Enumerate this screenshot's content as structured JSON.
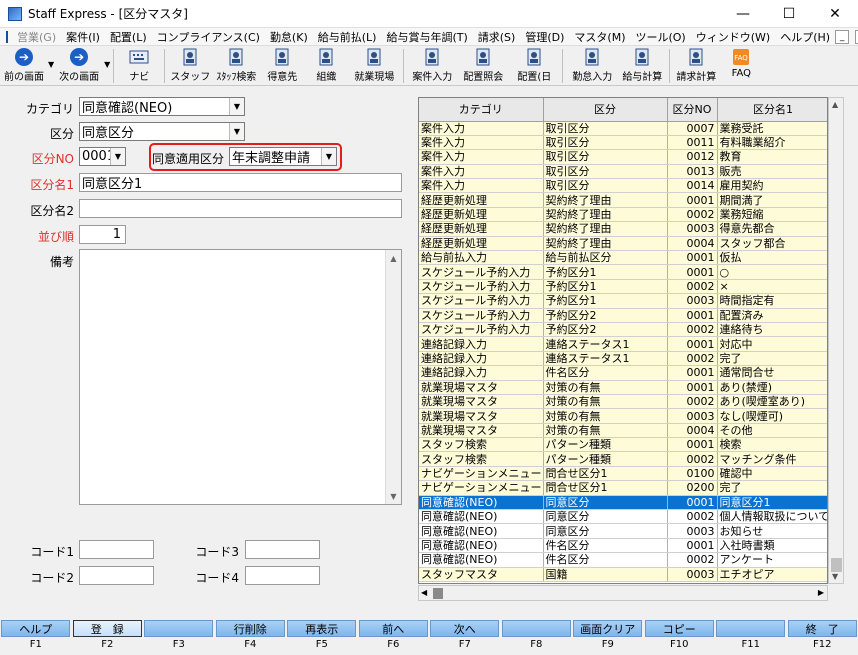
{
  "window": {
    "title": "Staff Express - [区分マスタ]"
  },
  "menu": [
    {
      "label": "営業(G)",
      "disabled": true
    },
    {
      "label": "案件(I)"
    },
    {
      "label": "配置(L)"
    },
    {
      "label": "コンプライアンス(C)"
    },
    {
      "label": "勤怠(K)"
    },
    {
      "label": "給与前払(L)"
    },
    {
      "label": "給与賞与年調(T)"
    },
    {
      "label": "請求(S)"
    },
    {
      "label": "管理(D)"
    },
    {
      "label": "マスタ(M)"
    },
    {
      "label": "ツール(O)"
    },
    {
      "label": "ウィンドウ(W)"
    },
    {
      "label": "ヘルプ(H)"
    }
  ],
  "toolbar": [
    {
      "label": "前の画面",
      "icon": "arrow-left-icon"
    },
    {
      "label": "次の画面",
      "icon": "arrow-right-icon"
    },
    {
      "label": "ナビ",
      "icon": "keyboard-icon"
    },
    {
      "label": "スタッフ",
      "icon": "staff-icon"
    },
    {
      "label": "ｽﾀｯﾌ検索",
      "icon": "staff-search-icon"
    },
    {
      "label": "得意先",
      "icon": "client-icon"
    },
    {
      "label": "組織",
      "icon": "org-icon"
    },
    {
      "label": "就業現場",
      "icon": "worksite-icon"
    },
    {
      "label": "案件入力",
      "icon": "job-input-icon"
    },
    {
      "label": "配置照会",
      "icon": "placement-inquiry-icon"
    },
    {
      "label": "配置(日",
      "icon": "placement-daily-icon"
    },
    {
      "label": "勤怠入力",
      "icon": "attendance-input-icon"
    },
    {
      "label": "給与計算",
      "icon": "payroll-icon"
    },
    {
      "label": "請求計算",
      "icon": "billing-icon"
    },
    {
      "label": "FAQ",
      "icon": "faq-icon"
    }
  ],
  "form": {
    "category_label": "カテゴリ",
    "category_value": "同意確認(NEO)",
    "kubun_label": "区分",
    "kubun_value": "同意区分",
    "kubun_no_label": "区分NO",
    "kubun_no_value": "0001",
    "consent_area_label": "同意適用区分",
    "consent_area_value": "年末調整申請",
    "kubun_name1_label": "区分名1",
    "kubun_name1_value": "同意区分1",
    "kubun_name2_label": "区分名2",
    "kubun_name2_value": "",
    "order_label": "並び順",
    "order_value": "1",
    "remarks_label": "備考",
    "code1_label": "コード1",
    "code2_label": "コード2",
    "code3_label": "コード3",
    "code4_label": "コード4"
  },
  "grid": {
    "columns": [
      "カテゴリ",
      "区分",
      "区分NO",
      "区分名1"
    ],
    "rows": [
      {
        "c": "案件入力",
        "k": "取引区分",
        "n": "0007",
        "m": "業務受託",
        "s": "y"
      },
      {
        "c": "案件入力",
        "k": "取引区分",
        "n": "0011",
        "m": "有料職業紹介",
        "s": "y"
      },
      {
        "c": "案件入力",
        "k": "取引区分",
        "n": "0012",
        "m": "教育",
        "s": "y"
      },
      {
        "c": "案件入力",
        "k": "取引区分",
        "n": "0013",
        "m": "販売",
        "s": "y"
      },
      {
        "c": "案件入力",
        "k": "取引区分",
        "n": "0014",
        "m": "雇用契約",
        "s": "y"
      },
      {
        "c": "経歴更新処理",
        "k": "契約終了理由",
        "n": "0001",
        "m": "期間満了",
        "s": "y"
      },
      {
        "c": "経歴更新処理",
        "k": "契約終了理由",
        "n": "0002",
        "m": "業務短縮",
        "s": "y"
      },
      {
        "c": "経歴更新処理",
        "k": "契約終了理由",
        "n": "0003",
        "m": "得意先都合",
        "s": "y"
      },
      {
        "c": "経歴更新処理",
        "k": "契約終了理由",
        "n": "0004",
        "m": "スタッフ都合",
        "s": "y"
      },
      {
        "c": "給与前払入力",
        "k": "給与前払区分",
        "n": "0001",
        "m": "仮払",
        "s": "y"
      },
      {
        "c": "スケジュール予約入力",
        "k": "予約区分1",
        "n": "0001",
        "m": "○",
        "s": "y"
      },
      {
        "c": "スケジュール予約入力",
        "k": "予約区分1",
        "n": "0002",
        "m": "×",
        "s": "y"
      },
      {
        "c": "スケジュール予約入力",
        "k": "予約区分1",
        "n": "0003",
        "m": "時間指定有",
        "s": "y"
      },
      {
        "c": "スケジュール予約入力",
        "k": "予約区分2",
        "n": "0001",
        "m": "配置済み",
        "s": "y"
      },
      {
        "c": "スケジュール予約入力",
        "k": "予約区分2",
        "n": "0002",
        "m": "連絡待ち",
        "s": "y"
      },
      {
        "c": "連絡記録入力",
        "k": "連絡ステータス1",
        "n": "0001",
        "m": "対応中",
        "s": "y"
      },
      {
        "c": "連絡記録入力",
        "k": "連絡ステータス1",
        "n": "0002",
        "m": "完了",
        "s": "y"
      },
      {
        "c": "連絡記録入力",
        "k": "件名区分",
        "n": "0001",
        "m": "通常問合せ",
        "s": "y"
      },
      {
        "c": "就業現場マスタ",
        "k": "対策の有無",
        "n": "0001",
        "m": "あり(禁煙)",
        "s": "y"
      },
      {
        "c": "就業現場マスタ",
        "k": "対策の有無",
        "n": "0002",
        "m": "あり(喫煙室あり)",
        "s": "y"
      },
      {
        "c": "就業現場マスタ",
        "k": "対策の有無",
        "n": "0003",
        "m": "なし(喫煙可)",
        "s": "y"
      },
      {
        "c": "就業現場マスタ",
        "k": "対策の有無",
        "n": "0004",
        "m": "その他",
        "s": "y"
      },
      {
        "c": "スタッフ検索",
        "k": "パターン種類",
        "n": "0001",
        "m": "検索",
        "s": "y"
      },
      {
        "c": "スタッフ検索",
        "k": "パターン種類",
        "n": "0002",
        "m": "マッチング条件",
        "s": "y"
      },
      {
        "c": "ナビゲーションメニュー",
        "k": "問合せ区分1",
        "n": "0100",
        "m": "確認中",
        "s": "y"
      },
      {
        "c": "ナビゲーションメニュー",
        "k": "問合せ区分1",
        "n": "0200",
        "m": "完了",
        "s": "y"
      },
      {
        "c": "同意確認(NEO)",
        "k": "同意区分",
        "n": "0001",
        "m": "同意区分1",
        "s": "sel"
      },
      {
        "c": "同意確認(NEO)",
        "k": "同意区分",
        "n": "0002",
        "m": "個人情報取扱について",
        "s": "w"
      },
      {
        "c": "同意確認(NEO)",
        "k": "同意区分",
        "n": "0003",
        "m": "お知らせ",
        "s": "w"
      },
      {
        "c": "同意確認(NEO)",
        "k": "件名区分",
        "n": "0001",
        "m": "入社時書類",
        "s": "w"
      },
      {
        "c": "同意確認(NEO)",
        "k": "件名区分",
        "n": "0002",
        "m": "アンケート",
        "s": "w"
      },
      {
        "c": "スタッフマスタ",
        "k": "国籍",
        "n": "0003",
        "m": "エチオピア",
        "s": "y"
      }
    ]
  },
  "fkeys": [
    {
      "label": "ヘルプ",
      "key": "F1"
    },
    {
      "label": "登　録",
      "key": "F2",
      "pressed": true
    },
    {
      "label": "",
      "key": "F3"
    },
    {
      "label": "行削除",
      "key": "F4"
    },
    {
      "label": "再表示",
      "key": "F5"
    },
    {
      "label": "前へ",
      "key": "F6"
    },
    {
      "label": "次へ",
      "key": "F7"
    },
    {
      "label": "",
      "key": "F8"
    },
    {
      "label": "画面クリア",
      "key": "F9"
    },
    {
      "label": "コピー",
      "key": "F10"
    },
    {
      "label": "",
      "key": "F11"
    },
    {
      "label": "終　了",
      "key": "F12"
    }
  ]
}
